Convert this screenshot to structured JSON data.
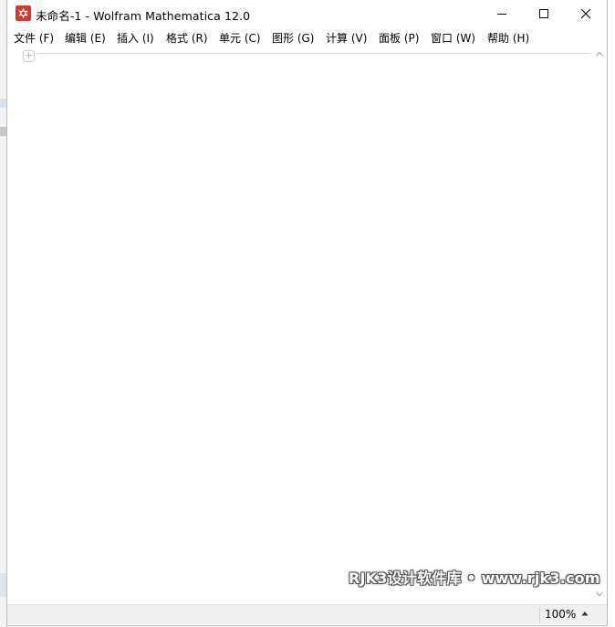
{
  "window": {
    "title": "未命名-1 - Wolfram Mathematica 12.0",
    "app_icon": "mathematica-spikey-icon",
    "controls": [
      "minimize-icon",
      "maximize-icon",
      "close-icon"
    ]
  },
  "menu": {
    "items": [
      {
        "label": "文件 (F)"
      },
      {
        "label": "编辑 (E)"
      },
      {
        "label": "插入 (I)"
      },
      {
        "label": "格式 (R)"
      },
      {
        "label": "单元 (C)"
      },
      {
        "label": "图形 (G)"
      },
      {
        "label": "计算 (V)"
      },
      {
        "label": "面板 (P)"
      },
      {
        "label": "窗口 (W)"
      },
      {
        "label": "帮助 (H)"
      }
    ]
  },
  "notebook": {
    "cell_insert_symbol": "+"
  },
  "statusbar": {
    "zoom": "100%",
    "zoom_arrow_icon": "triangle-up-icon"
  },
  "watermark": {
    "text": "RJK3设计软件库 • www.rjk3.com"
  },
  "colors": {
    "app_icon": "#d33a2c",
    "statusbar_bg": "#f0f0f0"
  }
}
